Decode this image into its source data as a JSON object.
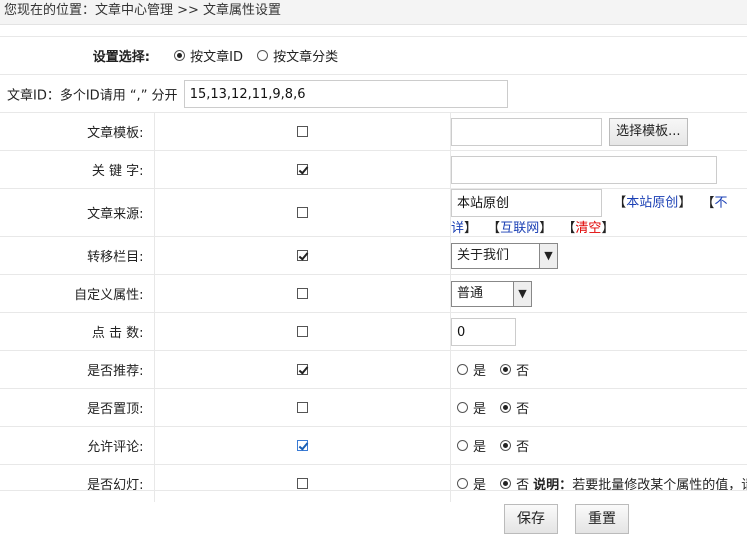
{
  "breadcrumb": "您现在的位置：文章中心管理 >> 文章属性设置",
  "select_mode": {
    "label": "设置选择:",
    "opt_id": "按文章ID",
    "opt_cat": "按文章分类",
    "selected": "id"
  },
  "ids": {
    "label": "文章ID：多个ID请用 “,” 分开",
    "value": "15,13,12,11,9,8,6"
  },
  "template": {
    "label": "文章模板:",
    "checked": false,
    "value": "",
    "button": "选择模板..."
  },
  "keywords": {
    "label": "关 键 字:",
    "checked": true,
    "value": ""
  },
  "source": {
    "label": "文章来源:",
    "checked": false,
    "value": "本站原创",
    "links": [
      {
        "text": "本站原创",
        "color": "#1a3fb4"
      },
      {
        "text": "不详",
        "color": "#1a3fb4"
      },
      {
        "text": "互联网",
        "color": "#1a3fb4"
      },
      {
        "text": "清空",
        "color": "#e00000"
      }
    ]
  },
  "move_column": {
    "label": "转移栏目:",
    "checked": true,
    "selected": "关于我们"
  },
  "custom_attr": {
    "label": "自定义属性:",
    "checked": false,
    "selected": "普通"
  },
  "hits": {
    "label": "点 击 数:",
    "checked": false,
    "value": "0"
  },
  "recommend": {
    "label": "是否推荐:",
    "checked": true,
    "yes": "是",
    "no": "否",
    "selected": "no"
  },
  "top": {
    "label": "是否置顶:",
    "checked": false,
    "yes": "是",
    "no": "否",
    "selected": "no"
  },
  "comment": {
    "label": "允许评论:",
    "checked": true,
    "yes": "是",
    "no": "否",
    "selected": "no"
  },
  "slide": {
    "label": "是否幻灯:",
    "checked": false,
    "yes": "是",
    "no": "否",
    "selected": "no",
    "note_title": "说明：",
    "note_text": "若要批量修改某个属性的值，请先选中其左侧的复选框，然后再设定属性值。"
  },
  "buttons": {
    "save": "保存",
    "reset": "重置"
  }
}
